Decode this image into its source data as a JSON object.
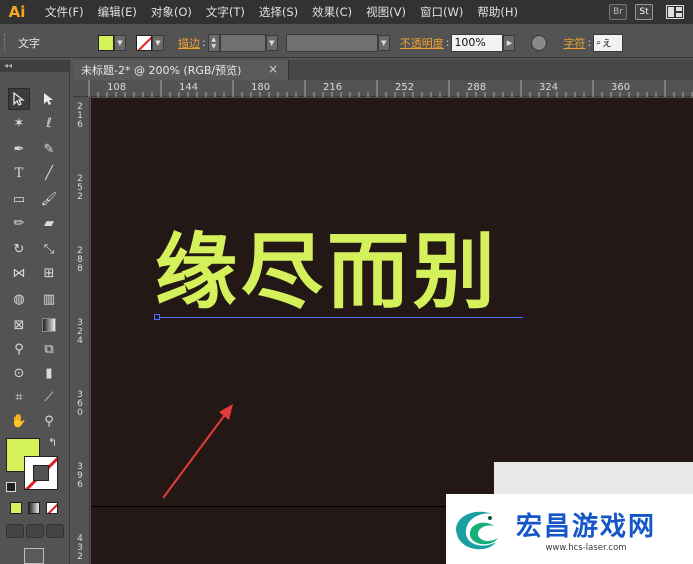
{
  "app": {
    "logo": "Ai"
  },
  "menu": [
    "文件(F)",
    "编辑(E)",
    "对象(O)",
    "文字(T)",
    "选择(S)",
    "效果(C)",
    "视图(V)",
    "窗口(W)",
    "帮助(H)"
  ],
  "menu_right": {
    "br": "Br",
    "st": "St"
  },
  "control_bar": {
    "type_label": "文字",
    "fill_color": "#d4f05a",
    "stroke_label": "描边",
    "opacity_label": "不透明度",
    "opacity_value": "100%",
    "char_label": "字符",
    "font_field": "ぇ"
  },
  "document_tab": {
    "title": "未标题-2* @ 200% (RGB/预览)",
    "close": "×"
  },
  "ruler_top": [
    "108",
    "144",
    "180",
    "216",
    "252",
    "288",
    "324",
    "360"
  ],
  "ruler_left": [
    "216",
    "252",
    "288",
    "324",
    "360",
    "396",
    "432"
  ],
  "canvas": {
    "background": "#231815",
    "headline": "缘尽而别",
    "headline_color": "#d4f05a",
    "baseline_color": "#4a6cff",
    "arrow_color": "#e53a3a"
  },
  "toolbox": {
    "fill_color": "#d4f05a"
  },
  "watermark": {
    "title": "宏昌游戏网",
    "url": "www.hcs-laser.com",
    "title_color": "#1556c8"
  }
}
